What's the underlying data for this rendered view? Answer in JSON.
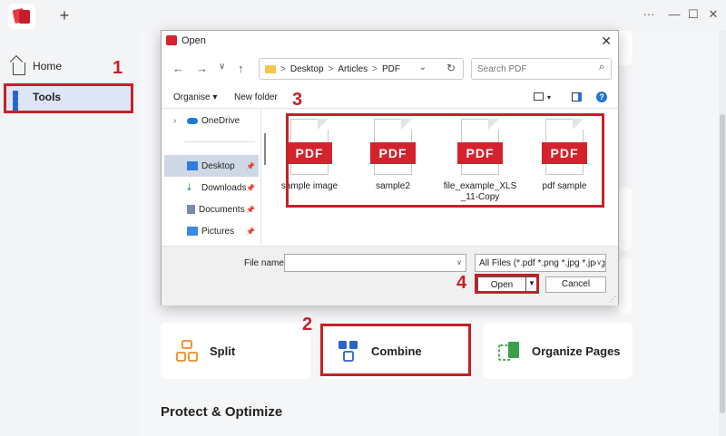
{
  "app": {
    "new_tab_glyph": "+",
    "menu_glyph": "···",
    "minimize_glyph": "—",
    "maximize_glyph": "☐",
    "close_glyph": "✕"
  },
  "sidebar": {
    "items": [
      {
        "label": "Home",
        "icon": "home-icon"
      },
      {
        "label": "Tools",
        "icon": "tools-icon",
        "selected": true
      }
    ]
  },
  "main": {
    "tools": [
      {
        "label": "Split",
        "icon": "split-icon"
      },
      {
        "label": "Combine",
        "icon": "combine-icon"
      },
      {
        "label": "Organize Pages",
        "icon": "organize-pages-icon"
      }
    ],
    "section_title": "Protect & Optimize"
  },
  "dialog": {
    "title": "Open",
    "close_glyph": "✕",
    "nav": {
      "back": "←",
      "forward": "→",
      "recent": "∨",
      "up": "↑"
    },
    "breadcrumb": [
      "Desktop",
      "Articles",
      "PDF"
    ],
    "breadcrumb_sep": ">",
    "search_placeholder": "Search PDF",
    "commands": {
      "organise": "Organise ▾",
      "new_folder": "New folder",
      "help": "?"
    },
    "tree": [
      {
        "label": "OneDrive",
        "icon": "onedrive-icon"
      },
      {
        "label": "Desktop",
        "icon": "desktop-icon",
        "selected": true
      },
      {
        "label": "Downloads",
        "icon": "download-icon"
      },
      {
        "label": "Documents",
        "icon": "documents-icon"
      },
      {
        "label": "Pictures",
        "icon": "pictures-icon"
      }
    ],
    "files": [
      {
        "name": "sample image",
        "badge": "PDF"
      },
      {
        "name": "sample2",
        "badge": "PDF"
      },
      {
        "name": "file_example_XLS_11-Copy",
        "badge": "PDF"
      },
      {
        "name": "pdf sample",
        "badge": "PDF"
      }
    ],
    "file_name_label": "File name:",
    "file_name_value": "",
    "file_type": "All Files (*.pdf *.png *.jpg *.jpeg",
    "open_label": "Open",
    "cancel_label": "Cancel"
  },
  "annotations": [
    "1",
    "2",
    "3",
    "4"
  ],
  "colors": {
    "highlight": "#c62028",
    "pdf_red": "#d4232c",
    "accent": "#2a63c9"
  }
}
